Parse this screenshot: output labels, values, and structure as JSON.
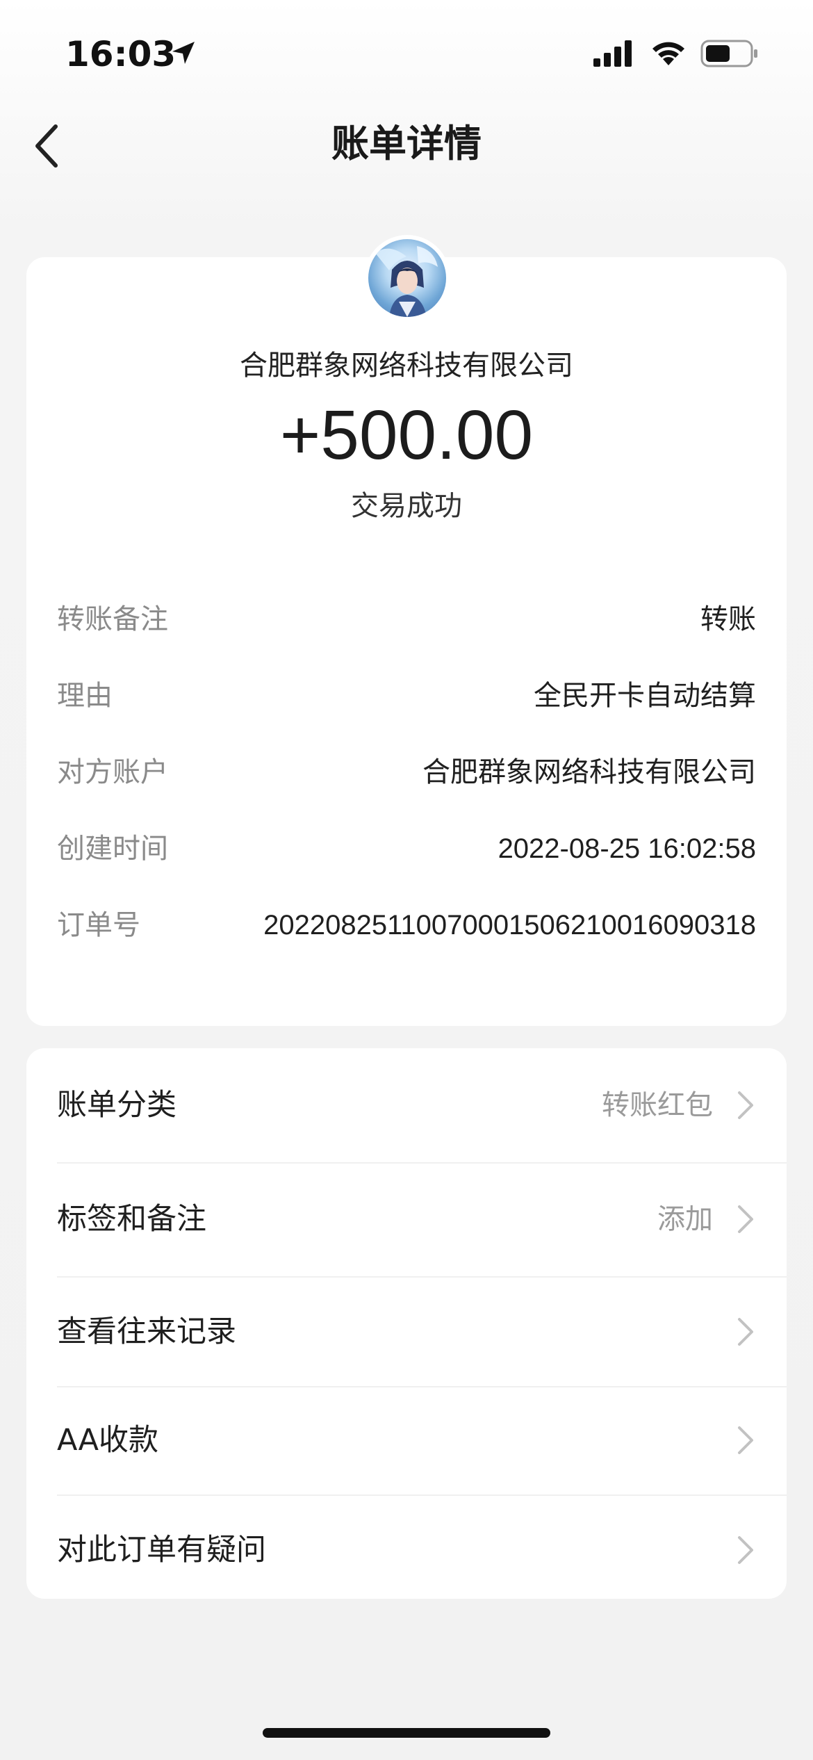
{
  "status_bar": {
    "time": "16:03",
    "icons": [
      "location-arrow-icon",
      "cellular-signal-icon",
      "wifi-icon",
      "battery-icon"
    ],
    "battery_level": 0.55
  },
  "nav": {
    "title": "账单详情",
    "back_icon": "chevron-left-icon"
  },
  "transaction": {
    "counterparty": "合肥群象网络科技有限公司",
    "amount": "+500.00",
    "status": "交易成功"
  },
  "details": [
    {
      "label": "转账备注",
      "value": "转账"
    },
    {
      "label": "理由",
      "value": "全民开卡自动结算"
    },
    {
      "label": "对方账户",
      "value": "合肥群象网络科技有限公司"
    },
    {
      "label": "创建时间",
      "value": "2022-08-25 16:02:58"
    },
    {
      "label": "订单号",
      "value": "20220825110070001506210016090318"
    }
  ],
  "actions": [
    {
      "label": "账单分类",
      "value": "转账红包"
    },
    {
      "label": "标签和备注",
      "value": "添加"
    },
    {
      "label": "查看往来记录",
      "value": ""
    },
    {
      "label": "AA收款",
      "value": ""
    },
    {
      "label": "对此订单有疑问",
      "value": ""
    }
  ],
  "colors": {
    "background": "#f2f2f2",
    "card": "#ffffff",
    "label_gray": "#8a8a8a",
    "text_dark": "#1f1f1f"
  }
}
